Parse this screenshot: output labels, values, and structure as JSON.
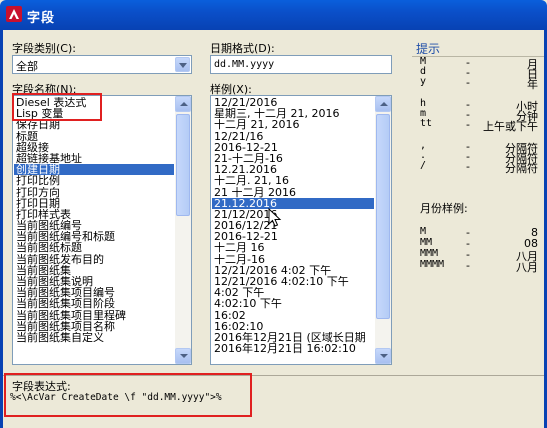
{
  "window": {
    "title": "字段"
  },
  "category": {
    "label": "字段类别(C):",
    "value": "全部"
  },
  "names": {
    "label": "字段名称(N):",
    "items": [
      "Diesel 表达式",
      "Lisp 变量",
      "保存日期",
      "标题",
      "超级接",
      "超链接基地址",
      "创建日期",
      "打印比例",
      "打印方向",
      "打印日期",
      "打印样式表",
      "当前图纸编号",
      "当前图纸编号和标题",
      "当前图纸标题",
      "当前图纸发布目的",
      "当前图纸集",
      "当前图纸集说明",
      "当前图纸集项目编号",
      "当前图纸集项目阶段",
      "当前图纸集项目里程碑",
      "当前图纸集项目名称",
      "当前图纸集自定义"
    ],
    "selected_index": 6
  },
  "date_format": {
    "label": "日期格式(D):",
    "value": "dd.MM.yyyy"
  },
  "examples": {
    "label": "样例(X):",
    "items": [
      "12/21/2016",
      "星期三, 十二月 21, 2016",
      "十二月 21, 2016",
      "12/21/16",
      "2016-12-21",
      "21-十二月-16",
      "12.21.2016",
      "十二月. 21, 16",
      "21 十二月 2016",
      "21.12.2016",
      "21/12/2016",
      "2016/12/21",
      "2016-12-21",
      "十二月 16",
      "十二月-16",
      "12/21/2016 4:02 下午",
      "12/21/2016 4:02:10 下午",
      "4:02 下午",
      "4:02:10 下午",
      "16:02",
      "16:02:10",
      "2016年12月21日 (区域长日期",
      "2016年12月21日 16:02:10"
    ],
    "selected_index": 9
  },
  "hints": {
    "title": "提示",
    "rows": [
      {
        "code": "M",
        "dash": "-",
        "desc": "月"
      },
      {
        "code": "d",
        "dash": "-",
        "desc": "日"
      },
      {
        "code": "y",
        "dash": "-",
        "desc": "年"
      },
      {
        "code": "h",
        "dash": "-",
        "desc": "小时"
      },
      {
        "code": "m",
        "dash": "-",
        "desc": "分钟"
      },
      {
        "code": "tt",
        "dash": "-",
        "desc": "上午或下午"
      },
      {
        "code": ",",
        "dash": "-",
        "desc": "分隔符"
      },
      {
        "code": ".",
        "dash": "-",
        "desc": "分隔符"
      },
      {
        "code": "/",
        "dash": "-",
        "desc": "分隔符"
      }
    ],
    "month_title": "月份样例:",
    "month_rows": [
      {
        "code": "M",
        "dash": "-",
        "desc": "8"
      },
      {
        "code": "MM",
        "dash": "-",
        "desc": "08"
      },
      {
        "code": "MMM",
        "dash": "-",
        "desc": "八月"
      },
      {
        "code": "MMMM",
        "dash": "-",
        "desc": "八月"
      }
    ]
  },
  "expression": {
    "label": "字段表达式:",
    "value": "%<\\AcVar CreateDate \\f \"dd.MM.yyyy\">%"
  },
  "colors": {
    "titlebar": "#0a4fc9",
    "selection": "#316ac5",
    "highlight_box": "#e02020",
    "hint_title": "#1f4ea8"
  },
  "icons": {
    "app": "autocad-logo-icon",
    "cursor": "mouse-cursor-icon"
  }
}
